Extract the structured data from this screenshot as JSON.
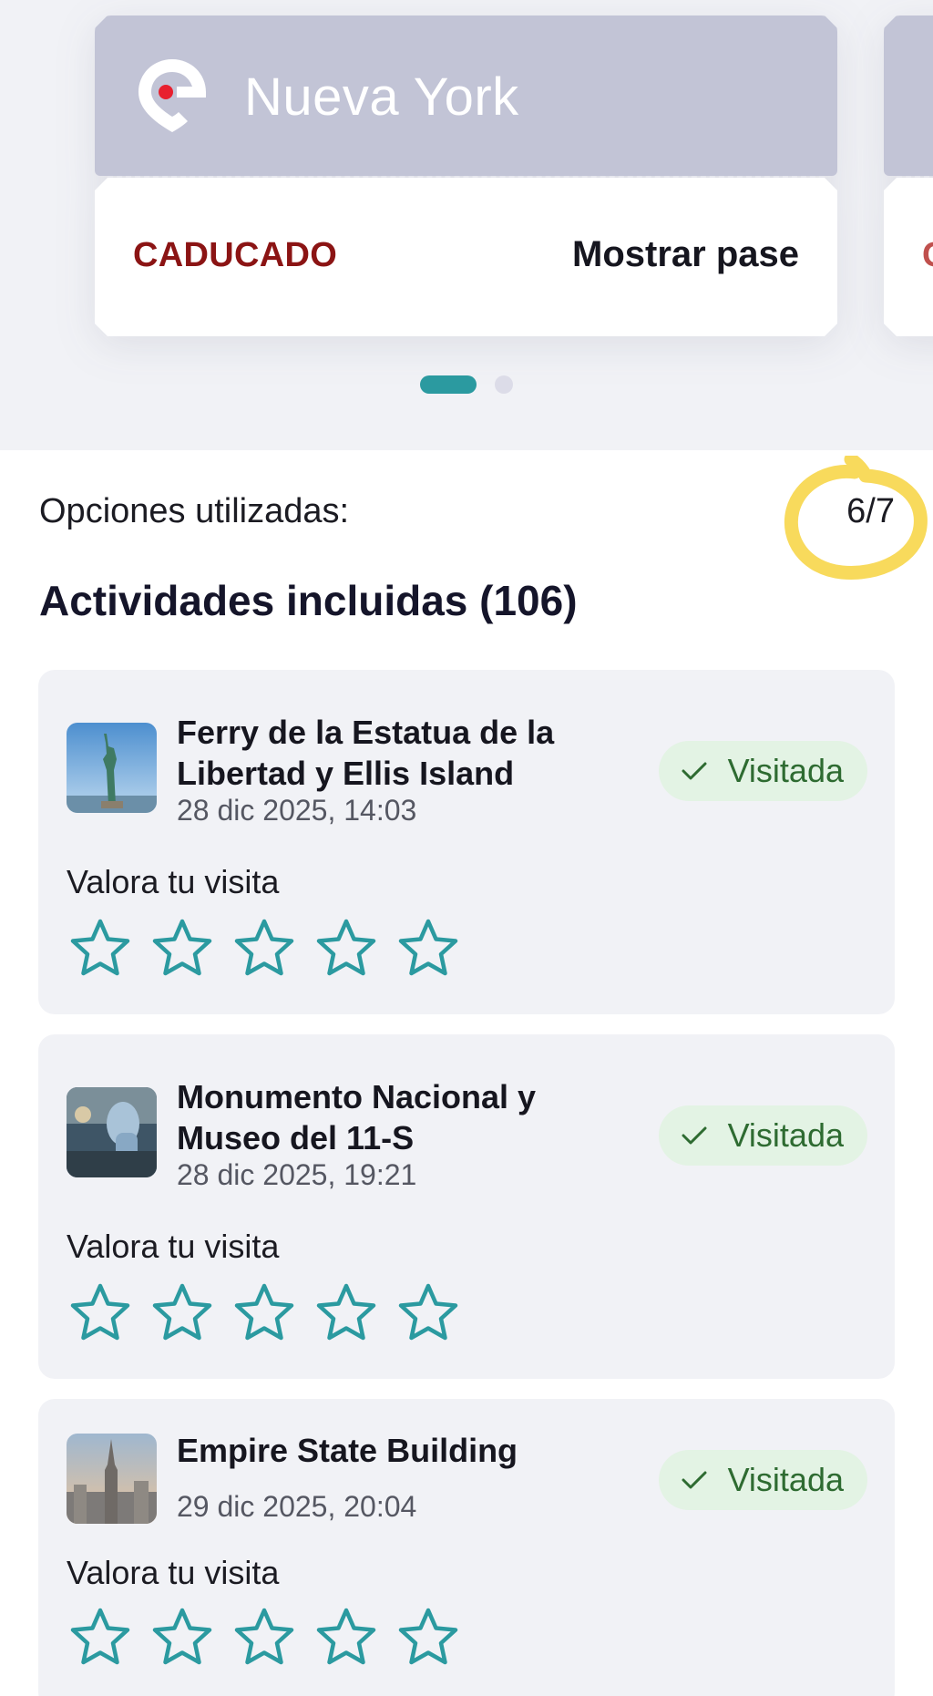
{
  "pass": {
    "city": "Nueva York",
    "status": "CADUCADO",
    "show_pass_label": "Mostrar pase",
    "peek_status": "C",
    "logo_icon": "location-pin-logo-icon",
    "top_color": "#c2c4d6",
    "status_color": "#8b1414"
  },
  "carousel": {
    "pages": 2,
    "active_page": 1
  },
  "usage": {
    "label": "Opciones utilizadas:",
    "value": "6/7"
  },
  "activities": {
    "title": "Actividades incluidas (106)",
    "items": [
      {
        "title": "Ferry de la Estatua de la Libertad y Ellis Island",
        "date": "28 dic 2025, 14:03",
        "status": "Visitada",
        "rate_label": "Valora tu visita",
        "rating": 0,
        "thumb": "statue-of-liberty-photo"
      },
      {
        "title": "Monumento Nacional y Museo del 11-S",
        "date": "28 dic 2025, 19:21",
        "status": "Visitada",
        "rate_label": "Valora tu visita",
        "rating": 0,
        "thumb": "9-11-memorial-photo"
      },
      {
        "title": "Empire State Building",
        "date": "29 dic 2025, 20:04",
        "status": "Visitada",
        "rate_label": "Valora tu visita",
        "rating": 0,
        "thumb": "empire-state-building-photo"
      }
    ]
  },
  "colors": {
    "accent": "#2b9aa0",
    "visited_bg": "#e3f3e4",
    "visited_text": "#2e6b31",
    "highlight": "#f7d64a"
  }
}
